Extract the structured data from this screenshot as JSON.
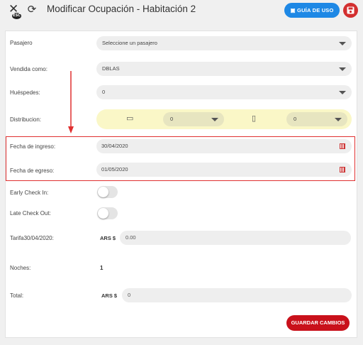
{
  "header": {
    "close_icon": "close-icon",
    "esc_badge": "ESC",
    "refresh_icon": "refresh-icon",
    "title": "Modificar Ocupación - Habitación 2",
    "guide_label": "GUÍA DE USO",
    "save_icon": "floppy-disk-icon"
  },
  "form": {
    "pasajero": {
      "label": "Pasajero",
      "value": "Seleccione un pasajero"
    },
    "vendida_como": {
      "label": "Vendida como:",
      "value": "DBLAS"
    },
    "huespedes": {
      "label": "Huéspedes:",
      "value": "0"
    },
    "distribucion": {
      "label": "Distribucion:",
      "bed_a_icon": "double-bed-icon",
      "bed_a_value": "0",
      "bed_b_icon": "single-bed-icon",
      "bed_b_value": "0"
    },
    "fecha_ingreso": {
      "label": "Fecha de ingreso:",
      "value": "30/04/2020",
      "icon": "calendar-icon"
    },
    "fecha_egreso": {
      "label": "Fecha de egreso:",
      "value": "01/05/2020",
      "icon": "calendar-icon"
    },
    "early_checkin": {
      "label": "Early Check In:",
      "on": false
    },
    "late_checkout": {
      "label": "Late Check Out:",
      "on": false
    },
    "tarifa": {
      "label": "Tarifa30/04/2020:",
      "currency": "ARS $",
      "value": "0.00"
    },
    "noches": {
      "label": "Noches:",
      "value": "1"
    },
    "total": {
      "label": "Total:",
      "currency": "ARS $",
      "value": "0"
    }
  },
  "actions": {
    "save_label": "GUARDAR CAMBIOS"
  },
  "colors": {
    "accent_blue": "#1e88e5",
    "save_red": "#c9111b",
    "highlight_red": "#e03030",
    "distribution_bg": "#faf7c7"
  }
}
